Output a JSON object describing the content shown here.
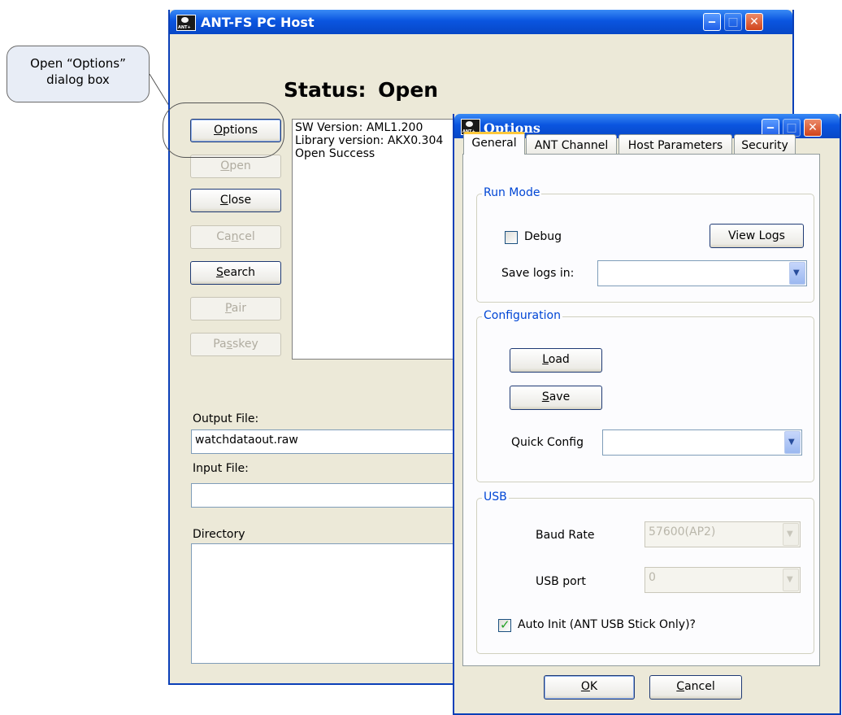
{
  "callout": {
    "line1": "Open “Options”",
    "line2": "dialog box"
  },
  "main_window": {
    "title": "ANT-FS PC Host",
    "status_label": "Status:",
    "status_value": "Open",
    "buttons": {
      "options": {
        "pre": "",
        "key": "O",
        "post": "ptions"
      },
      "open": {
        "pre": "",
        "key": "O",
        "post": "pen"
      },
      "close": {
        "pre": "",
        "key": "C",
        "post": "lose"
      },
      "cancel": {
        "pre": "Ca",
        "key": "n",
        "post": "cel"
      },
      "search": {
        "pre": "",
        "key": "S",
        "post": "earch"
      },
      "pair": {
        "pre": "",
        "key": "P",
        "post": "air"
      },
      "passkey": {
        "pre": "Pa",
        "key": "s",
        "post": "skey"
      }
    },
    "log_lines": [
      "SW Version: AML1.200",
      "Library version:  AKX0.304",
      "Open Success"
    ],
    "output_file_label": "Output File:",
    "output_file_value": "watchdataout.raw",
    "input_file_label": "Input File:",
    "input_file_value": "",
    "directory_label": "Directory"
  },
  "options_dialog": {
    "title": "Options",
    "tabs": [
      "General",
      "ANT Channel",
      "Host Parameters",
      "Security"
    ],
    "run_mode": {
      "title": "Run Mode",
      "debug_label": "Debug",
      "debug_checked": false,
      "view_logs_button": "View Logs",
      "save_logs_label": "Save logs in:",
      "save_logs_value": ""
    },
    "configuration": {
      "title": "Configuration",
      "load": {
        "key": "L",
        "post": "oad"
      },
      "save": {
        "key": "S",
        "post": "ave"
      },
      "quick_config_label": "Quick Config",
      "quick_config_value": ""
    },
    "usb": {
      "title": "USB",
      "baud_rate_label": "Baud Rate",
      "baud_rate_value": "57600(AP2)",
      "usb_port_label": "USB port",
      "usb_port_value": "0",
      "auto_init_label": "Auto Init (ANT USB Stick Only)?",
      "auto_init_checked": true
    },
    "ok": {
      "key": "O",
      "post": "K"
    },
    "cancel": {
      "key": "C",
      "post": "ancel"
    }
  },
  "colors": {
    "title_bar": "#0a55e0",
    "window_bg": "#ece9d8",
    "group_title": "#0046d5",
    "check": "#21a121",
    "close_button": "#d0431b"
  }
}
